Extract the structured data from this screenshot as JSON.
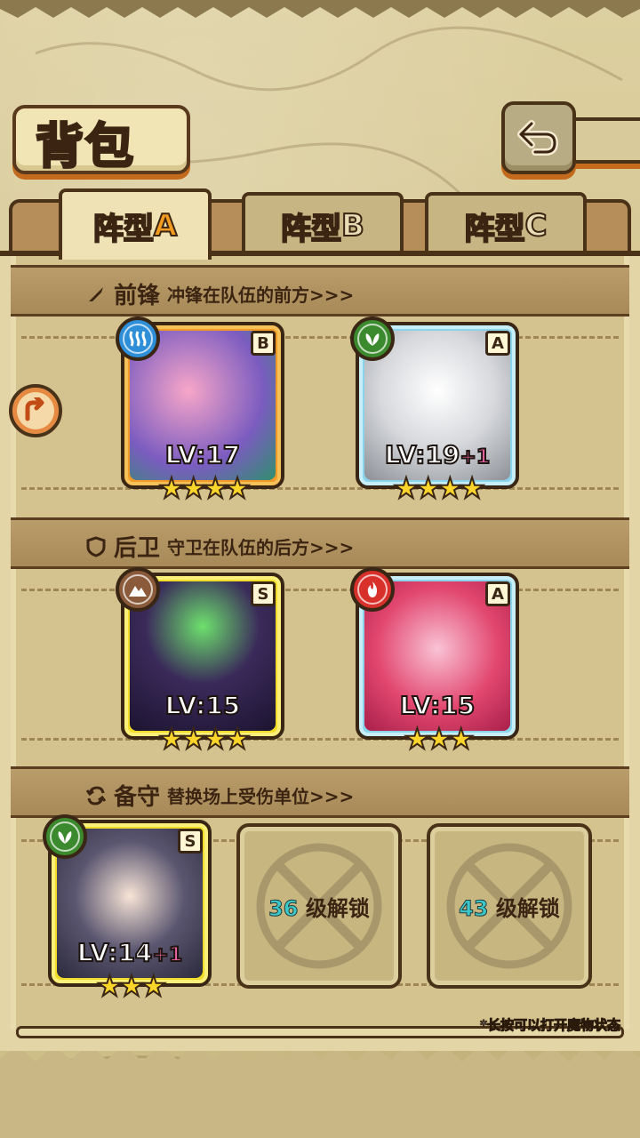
{
  "header": {
    "title": "背包"
  },
  "tabs": [
    {
      "label": "阵型",
      "letter": "A",
      "active": true
    },
    {
      "label": "阵型",
      "letter": "B",
      "active": false
    },
    {
      "label": "阵型",
      "letter": "C",
      "active": false
    }
  ],
  "sections": {
    "front": {
      "title": "前锋",
      "subtitle": "冲锋在队伍的前方>>>"
    },
    "back": {
      "title": "后卫",
      "subtitle": "守卫在队伍的后方>>>"
    },
    "reserve": {
      "title": "备守",
      "subtitle": "替换场上受伤单位>>>"
    }
  },
  "front_units": [
    {
      "rank": "B",
      "level": "LV:17",
      "plus": "",
      "stars": "★★★★",
      "element": "water",
      "element_color": "#2e8fd8",
      "frame": "orange"
    },
    {
      "rank": "A",
      "level": "LV:19",
      "plus": "+1",
      "stars": "★★★★",
      "element": "leaf",
      "element_color": "#3c8a2e",
      "frame": "blue"
    }
  ],
  "back_units": [
    {
      "rank": "S",
      "level": "LV:15",
      "plus": "",
      "stars": "★★★★",
      "element": "earth",
      "element_color": "#8a5a3a",
      "frame": "yellow"
    },
    {
      "rank": "A",
      "level": "LV:15",
      "plus": "",
      "stars": "★★★",
      "element": "fire",
      "element_color": "#d8302a",
      "frame": "blue"
    }
  ],
  "reserve_units": [
    {
      "rank": "S",
      "level": "LV:14",
      "plus": "+1",
      "stars": "★★★",
      "element": "leaf",
      "element_color": "#3c8a2e",
      "frame": "yellow"
    }
  ],
  "locked_slots": [
    {
      "level": "36",
      "label": "级解锁"
    },
    {
      "level": "43",
      "label": "级解锁"
    }
  ],
  "footer": {
    "hint": "*长按可以打开魔物状态"
  }
}
